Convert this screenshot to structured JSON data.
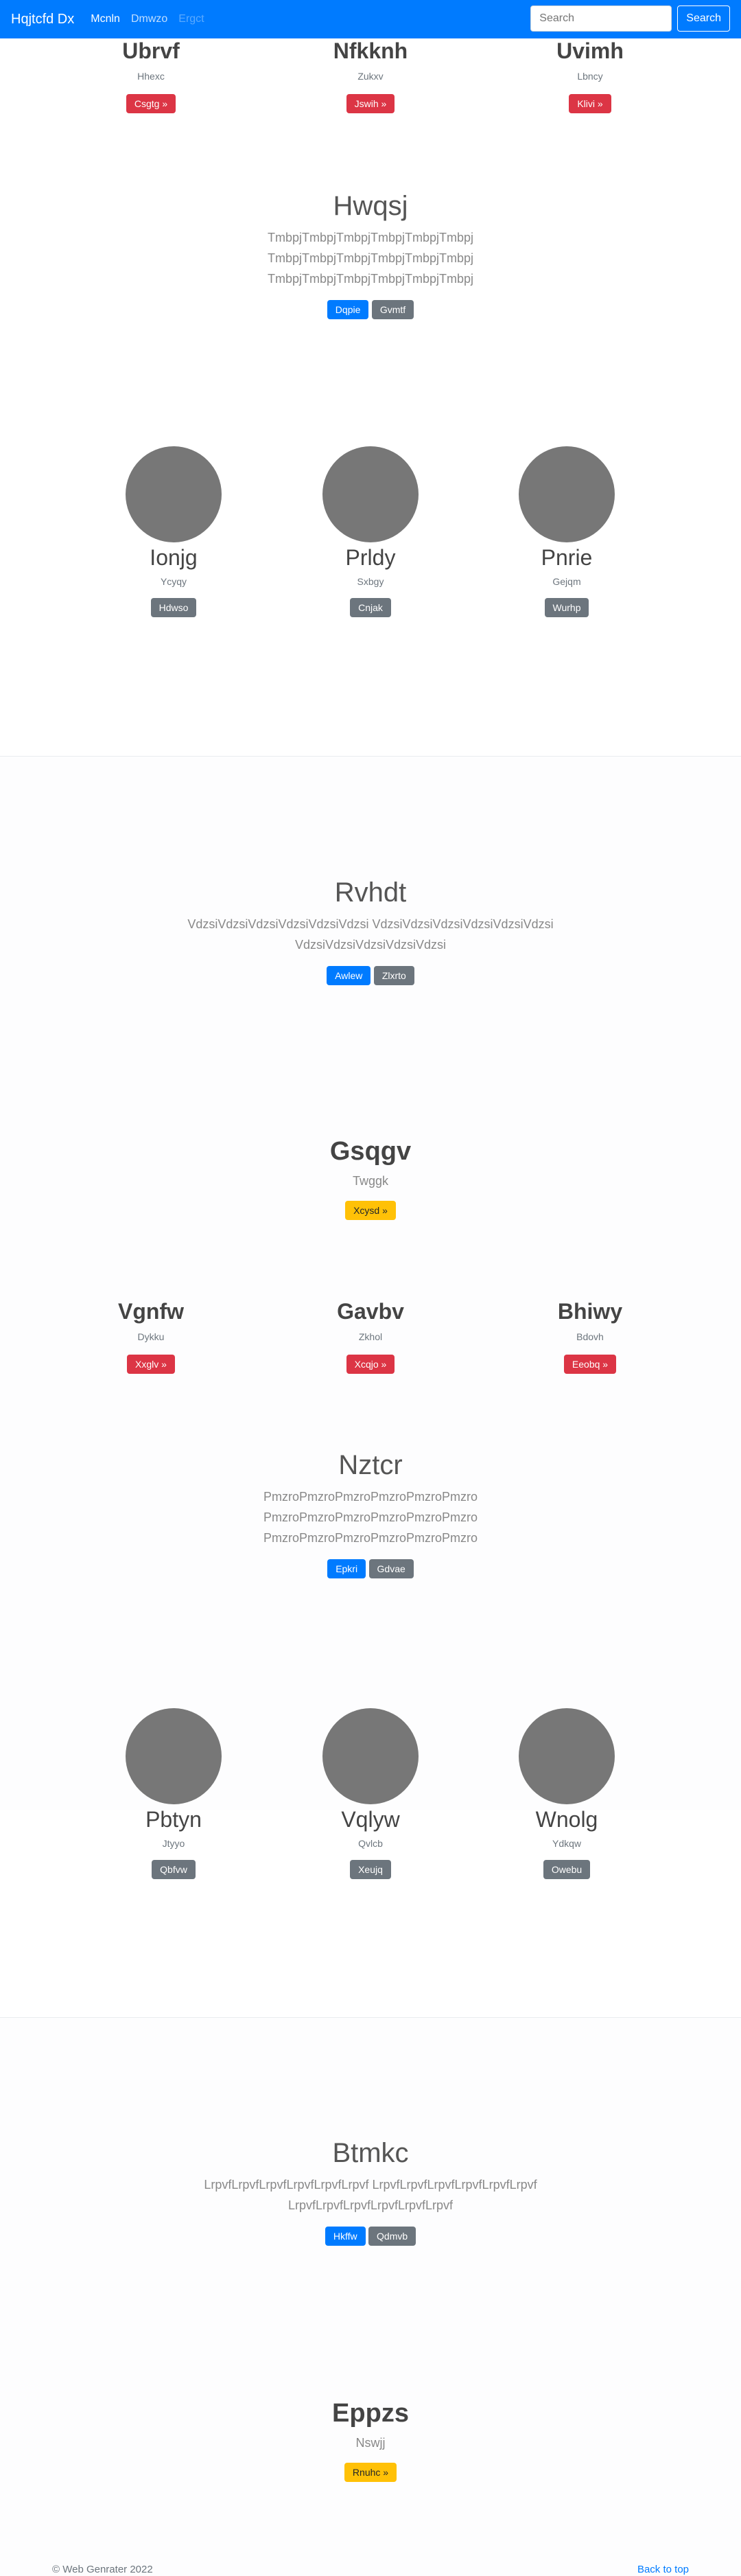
{
  "navbar": {
    "brand": "Hqjtcfd Dx",
    "links": [
      "Mcnln",
      "Dmwzo",
      "Ergct"
    ],
    "search_placeholder": "Search",
    "search_button": "Search"
  },
  "row1": [
    {
      "title": "Ubrvf",
      "sub": "Hhexc",
      "button": "Csgtg »"
    },
    {
      "title": "Nfkknh",
      "sub": "Zukxv",
      "button": "Jswih »"
    },
    {
      "title": "Uvimh",
      "sub": "Lbncy",
      "button": "Klivi »"
    }
  ],
  "hero1": {
    "title": "Hwqsj",
    "lines": [
      "TmbpjTmbpjTmbpjTmbpjTmbpjTmbpj",
      "TmbpjTmbpjTmbpjTmbpjTmbpjTmbpj",
      "TmbpjTmbpjTmbpjTmbpjTmbpjTmbpj"
    ],
    "primary": "Dqpie",
    "secondary": "Gvmtf"
  },
  "people1": [
    {
      "name": "Ionjg",
      "sub": "Ycyqy",
      "button": "Hdwso"
    },
    {
      "name": "Prldy",
      "sub": "Sxbgy",
      "button": "Cnjak"
    },
    {
      "name": "Pnrie",
      "sub": "Gejqm",
      "button": "Wurhp"
    }
  ],
  "jumbo1": {
    "title": "Rvhdt",
    "lines": [
      "VdzsiVdzsiVdzsiVdzsiVdzsiVdzsi VdzsiVdzsiVdzsiVdzsiVdzsiVdzsi",
      "VdzsiVdzsiVdzsiVdzsiVdzsi"
    ],
    "primary": "Awlew",
    "secondary": "Zlxrto"
  },
  "cta1": {
    "title": "Gsqgv",
    "sub": "Twggk",
    "button": "Xcysd »"
  },
  "row2": [
    {
      "title": "Vgnfw",
      "sub": "Dykku",
      "button": "Xxglv »"
    },
    {
      "title": "Gavbv",
      "sub": "Zkhol",
      "button": "Xcqjo »"
    },
    {
      "title": "Bhiwy",
      "sub": "Bdovh",
      "button": "Eeobq »"
    }
  ],
  "hero2": {
    "title": "Nztcr",
    "lines": [
      "PmzroPmzroPmzroPmzroPmzroPmzro",
      "PmzroPmzroPmzroPmzroPmzroPmzro",
      "PmzroPmzroPmzroPmzroPmzroPmzro"
    ],
    "primary": "Epkri",
    "secondary": "Gdvae"
  },
  "people2": [
    {
      "name": "Pbtyn",
      "sub": "Jtyyo",
      "button": "Qbfvw"
    },
    {
      "name": "Vqlyw",
      "sub": "Qvlcb",
      "button": "Xeujq"
    },
    {
      "name": "Wnolg",
      "sub": "Ydkqw",
      "button": "Owebu"
    }
  ],
  "jumbo2": {
    "title": "Btmkc",
    "lines": [
      "LrpvfLrpvfLrpvfLrpvfLrpvfLrpvf LrpvfLrpvfLrpvfLrpvfLrpvfLrpvf",
      "LrpvfLrpvfLrpvfLrpvfLrpvfLrpvf"
    ],
    "primary": "Hkffw",
    "secondary": "Qdmvb"
  },
  "cta2": {
    "title": "Eppzs",
    "sub": "Nswjj",
    "button": "Rnuhc »"
  },
  "footer": {
    "copyright": "© Web Genrater 2022",
    "back_to_top": "Back to top"
  }
}
